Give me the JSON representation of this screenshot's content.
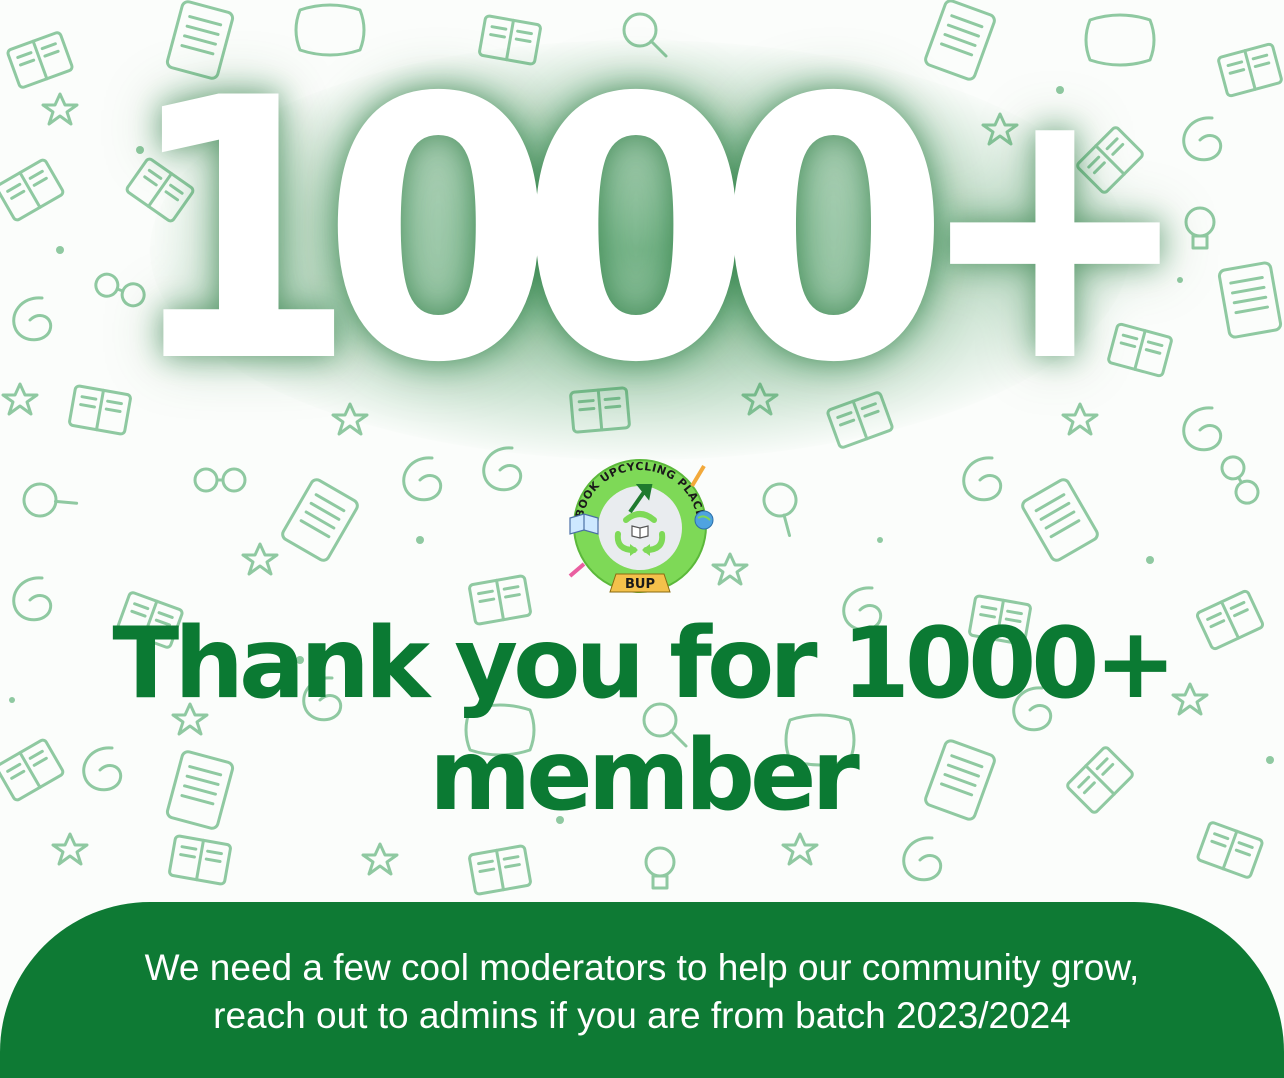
{
  "headline_number": "1000+",
  "logo": {
    "ring_text": "BOOK UPCYCLING PLACE",
    "badge": "BUP"
  },
  "headline": {
    "line1": "Thank you for 1000+",
    "line2": "member"
  },
  "footer": {
    "line1": "We need a few cool moderators to help our community grow,",
    "line2": "reach out to admins if you are from batch 2023/2024"
  },
  "colors": {
    "brand_green": "#0b7a33",
    "footer_green": "#0e7a34",
    "doodle_green": "#8fc9a1",
    "logo_green": "#7ed957"
  },
  "icons": [
    "book-icon",
    "star-icon",
    "glasses-icon",
    "magnifier-icon",
    "lightbulb-icon",
    "tablet-icon",
    "pillow-icon",
    "swirl-icon",
    "recycle-icon"
  ]
}
